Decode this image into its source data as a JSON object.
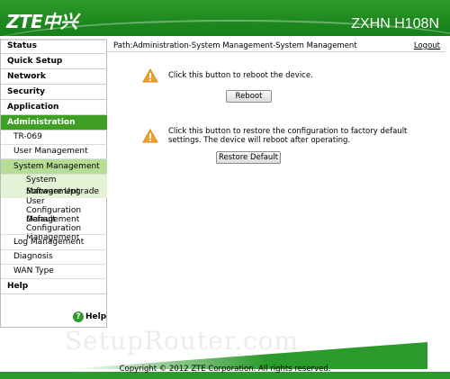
{
  "header": {
    "logo_text": "ZTE中兴",
    "product": "ZXHN H108N"
  },
  "sidebar": {
    "items": [
      {
        "label": "Status"
      },
      {
        "label": "Quick Setup"
      },
      {
        "label": "Network"
      },
      {
        "label": "Security"
      },
      {
        "label": "Application"
      },
      {
        "label": "Administration"
      },
      {
        "label": "TR-069"
      },
      {
        "label": "User Management"
      },
      {
        "label": "System Management"
      },
      {
        "label": "System Management"
      },
      {
        "label": "Software Upgrade"
      },
      {
        "label": "User Configuration Management"
      },
      {
        "label": "Default Configuration Management"
      },
      {
        "label": "Log Management"
      },
      {
        "label": "Diagnosis"
      },
      {
        "label": "WAN Type"
      },
      {
        "label": "Help"
      }
    ],
    "help_icon": "?",
    "help_bottom": "Help"
  },
  "main": {
    "path": "Path:Administration-System Management-System Management",
    "logout": "Logout",
    "reboot_msg": "Click this button to reboot the device.",
    "reboot_btn": "Reboot",
    "restore_msg_1": "Click this button to restore the configuration to factory default",
    "restore_msg_2": "settings. The device will reboot after operating.",
    "restore_btn": "Restore Default"
  },
  "watermark": "SetupRouter.com",
  "footer": {
    "copyright": "Copyright © 2012 ZTE Corporation. All rights reserved."
  },
  "colors": {
    "brand_green": "#2d9a2d",
    "active_nav": "#3f9f24",
    "active_sub": "#b6dd96",
    "warning": "#f2a024"
  }
}
